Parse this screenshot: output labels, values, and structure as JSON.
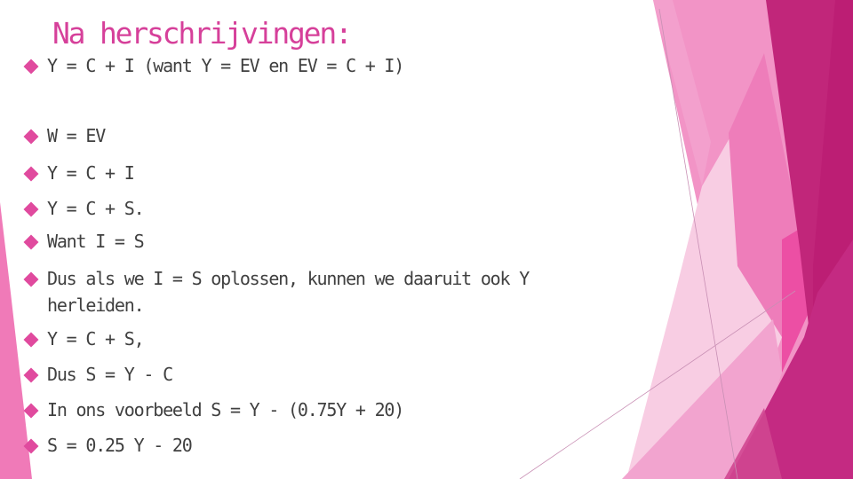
{
  "slide": {
    "title": "Na herschrijvingen:",
    "bullets": [
      {
        "text": "Y = C + I (want Y = EV en EV = C + I)"
      },
      {
        "text": "W = EV"
      },
      {
        "text": "Y = C + I"
      },
      {
        "text": "Y = C + S."
      },
      {
        "text": "Want I = S"
      },
      {
        "text": "Dus als we I = S oplossen, kunnen we daaruit ook Y",
        "continuation": "herleiden."
      },
      {
        "text": "Y = C + S,"
      },
      {
        "text": "Dus S = Y - C"
      },
      {
        "text": "In ons voorbeeld S = Y - (0.75Y + 20)"
      },
      {
        "text": "S = 0.25 Y - 20"
      }
    ]
  },
  "theme": {
    "title_color": "#D6409A",
    "text_color": "#404040",
    "bullet_color": "#E04A9E",
    "bullet_icon": "diamond-bullet"
  }
}
